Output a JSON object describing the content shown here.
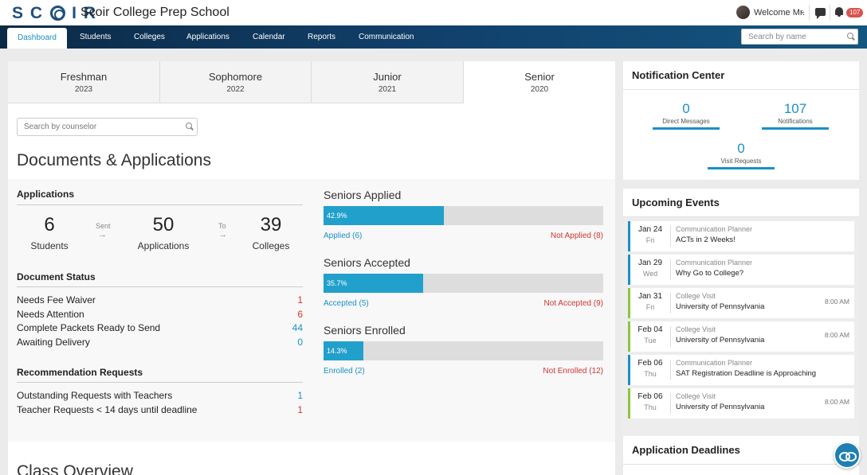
{
  "header": {
    "logo": "SCOIR",
    "school_name": "Scoir College Prep School",
    "welcome": "Welcome Mr.",
    "notification_badge": "107"
  },
  "nav": {
    "items": [
      "Dashboard",
      "Students",
      "Colleges",
      "Applications",
      "Calendar",
      "Reports",
      "Communication"
    ],
    "active": "Dashboard",
    "search_placeholder": "Search by name"
  },
  "year_tabs": [
    {
      "name": "Freshman",
      "year": "2023"
    },
    {
      "name": "Sophomore",
      "year": "2022"
    },
    {
      "name": "Junior",
      "year": "2021"
    },
    {
      "name": "Senior",
      "year": "2020"
    }
  ],
  "active_year_tab": "Senior",
  "counselor_search_placeholder": "Search by counselor",
  "section_title": "Documents & Applications",
  "applications": {
    "title": "Applications",
    "students": {
      "value": "6",
      "label": "Students"
    },
    "sent_label": "Sent",
    "applications": {
      "value": "50",
      "label": "Applications"
    },
    "to_label": "To",
    "colleges": {
      "value": "39",
      "label": "Colleges"
    }
  },
  "document_status": {
    "title": "Document Status",
    "rows": [
      {
        "label": "Needs Fee Waiver",
        "value": "1",
        "color": "#d0352f"
      },
      {
        "label": "Needs Attention",
        "value": "6",
        "color": "#d0352f"
      },
      {
        "label": "Complete Packets Ready to Send",
        "value": "44",
        "color": "#1a90c8"
      },
      {
        "label": "Awaiting Delivery",
        "value": "0",
        "color": "#1a90c8"
      }
    ]
  },
  "recommendations": {
    "title": "Recommendation Requests",
    "rows": [
      {
        "label": "Outstanding Requests with Teachers",
        "value": "1",
        "color": "#1a90c8"
      },
      {
        "label": "Teacher Requests < 14 days until deadline",
        "value": "1",
        "color": "#d0352f"
      }
    ]
  },
  "progress": [
    {
      "title": "Seniors Applied",
      "percent": 42.9,
      "percent_label": "42.9%",
      "left": "Applied (6)",
      "right": "Not Applied (8)"
    },
    {
      "title": "Seniors Accepted",
      "percent": 35.7,
      "percent_label": "35.7%",
      "left": "Accepted (5)",
      "right": "Not Accepted (9)"
    },
    {
      "title": "Seniors Enrolled",
      "percent": 14.3,
      "percent_label": "14.3%",
      "left": "Enrolled (2)",
      "right": "Not Enrolled (12)"
    }
  ],
  "class_overview_title": "Class Overview",
  "notification_center": {
    "title": "Notification Center",
    "direct_messages": {
      "value": "0",
      "label": "Direct Messages"
    },
    "notifications": {
      "value": "107",
      "label": "Notifications"
    },
    "visit_requests": {
      "value": "0",
      "label": "Visit Requests"
    }
  },
  "upcoming_events": {
    "title": "Upcoming Events",
    "items": [
      {
        "date": "Jan 24",
        "weekday": "Fri",
        "type": "Communication Planner",
        "title": "ACTs in 2 Weeks!",
        "time": "",
        "accent": "#1a90c8"
      },
      {
        "date": "Jan 29",
        "weekday": "Wed",
        "type": "Communication Planner",
        "title": "Why Go to College?",
        "time": "",
        "accent": "#1a90c8"
      },
      {
        "date": "Jan 31",
        "weekday": "Fri",
        "type": "College Visit",
        "title": "University of Pennsylvania",
        "time": "8:00 AM",
        "accent": "#8cc63e"
      },
      {
        "date": "Feb 04",
        "weekday": "Tue",
        "type": "College Visit",
        "title": "University of Pennsylvania",
        "time": "8:00 AM",
        "accent": "#8cc63e"
      },
      {
        "date": "Feb 06",
        "weekday": "Thu",
        "type": "Communication Planner",
        "title": "SAT Registration Deadline is Approaching",
        "time": "",
        "accent": "#1a90c8"
      },
      {
        "date": "Feb 06",
        "weekday": "Thu",
        "type": "College Visit",
        "title": "University of Pennsylvania",
        "time": "8:00 AM",
        "accent": "#8cc63e"
      }
    ]
  },
  "application_deadlines": {
    "title": "Application Deadlines"
  }
}
